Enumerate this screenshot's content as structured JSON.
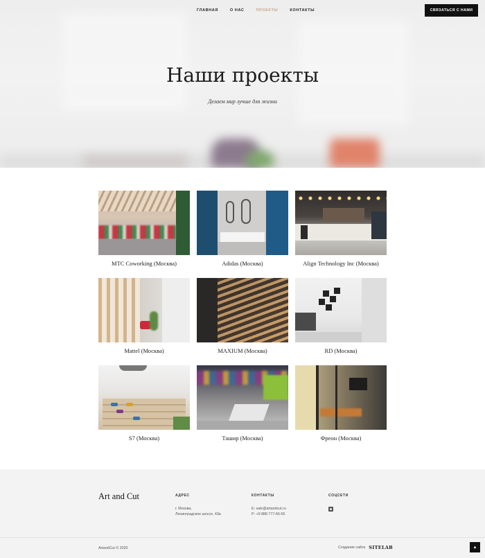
{
  "nav": {
    "items": [
      {
        "label": "ГЛАВНАЯ",
        "active": false
      },
      {
        "label": "О НАС",
        "active": false
      },
      {
        "label": "ПРОЕКТЫ",
        "active": true
      },
      {
        "label": "КОНТАКТЫ",
        "active": false
      }
    ],
    "contact_button": "СВЯЗАТЬСЯ С НАМИ"
  },
  "hero": {
    "title": "Наши проекты",
    "subtitle": "Делаем мир лучше для жизни"
  },
  "projects": [
    {
      "caption": "МТС Coworking (Москва)"
    },
    {
      "caption": "Adidas (Москва)"
    },
    {
      "caption": "Align Technology Inc (Москва)"
    },
    {
      "caption": "Mattel (Москва)"
    },
    {
      "caption": "MAXIUM (Москва)"
    },
    {
      "caption": "RD (Москва)"
    },
    {
      "caption": "S7 (Москва)"
    },
    {
      "caption": "Ташир (Москва)"
    },
    {
      "caption": "Фреон (Москва)"
    }
  ],
  "footer": {
    "brand": "Art and Cut",
    "address": {
      "heading": "АДРЕС",
      "line1": "г. Москва,",
      "line2": "Ленинградское шоссе, 43а"
    },
    "contacts": {
      "heading": "КОНТАКТЫ",
      "email": "E: sale@artandcut.ru",
      "phone": "P: +9 888 777-66-55"
    },
    "social": {
      "heading": "СОЦСЕТИ",
      "icon": "instagram-icon"
    },
    "copyright": "ArtandCut © 2020",
    "made_by": "Создание сайта",
    "made_by_logo": "SITELAB"
  },
  "colors": {
    "accent": "#c9a48a",
    "button_bg": "#111111",
    "footer_bg": "#f3f3f3"
  }
}
